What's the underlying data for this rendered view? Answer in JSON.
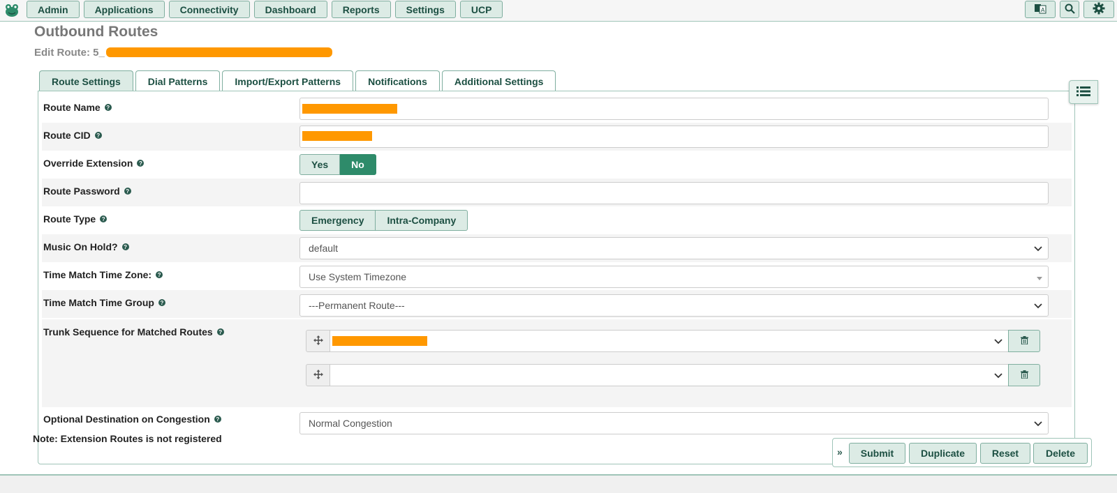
{
  "nav": {
    "items": [
      {
        "label": "Admin"
      },
      {
        "label": "Applications"
      },
      {
        "label": "Connectivity"
      },
      {
        "label": "Dashboard"
      },
      {
        "label": "Reports"
      },
      {
        "label": "Settings"
      },
      {
        "label": "UCP"
      }
    ],
    "right_icons": [
      "language-icon",
      "search-icon",
      "gear-icon"
    ]
  },
  "page": {
    "title": "Outbound Routes",
    "edit_prefix": "Edit Route: 5_"
  },
  "tabs": [
    {
      "label": "Route Settings",
      "active": true
    },
    {
      "label": "Dial Patterns",
      "active": false
    },
    {
      "label": "Import/Export Patterns",
      "active": false
    },
    {
      "label": "Notifications",
      "active": false
    },
    {
      "label": "Additional Settings",
      "active": false
    }
  ],
  "form": {
    "route_name": {
      "label": "Route Name"
    },
    "route_cid": {
      "label": "Route CID"
    },
    "override_extension": {
      "label": "Override Extension",
      "options": [
        "Yes",
        "No"
      ],
      "selected": "No"
    },
    "route_password": {
      "label": "Route Password",
      "value": ""
    },
    "route_type": {
      "label": "Route Type",
      "options": [
        "Emergency",
        "Intra-Company"
      ]
    },
    "music_on_hold": {
      "label": "Music On Hold?",
      "value": "default"
    },
    "time_zone": {
      "label": "Time Match Time Zone:",
      "value": "Use System Timezone"
    },
    "time_group": {
      "label": "Time Match Time Group",
      "value": "---Permanent Route---"
    },
    "trunk_sequence": {
      "label": "Trunk Sequence for Matched Routes"
    },
    "congestion": {
      "label": "Optional Destination on Congestion",
      "value": "Normal Congestion"
    }
  },
  "note": "Note: Extension Routes is not registered",
  "actions": {
    "submit": "Submit",
    "duplicate": "Duplicate",
    "reset": "Reset",
    "delete": "Delete"
  },
  "colors": {
    "accent": "#2e8b6a",
    "button_bg": "#dcebe5",
    "redaction": "#ff9800"
  }
}
